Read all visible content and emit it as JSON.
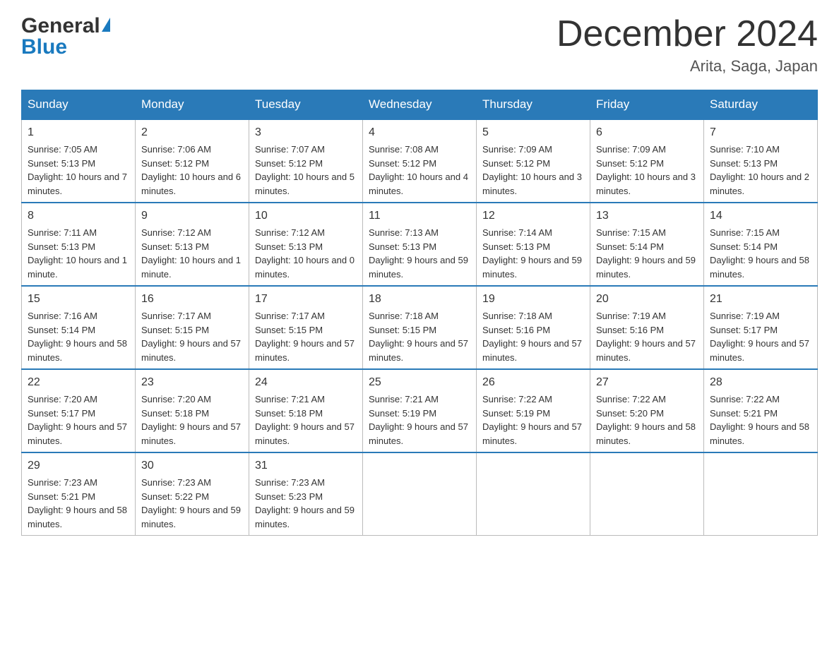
{
  "header": {
    "logo_general": "General",
    "logo_blue": "Blue",
    "month_title": "December 2024",
    "location": "Arita, Saga, Japan"
  },
  "calendar": {
    "days_of_week": [
      "Sunday",
      "Monday",
      "Tuesday",
      "Wednesday",
      "Thursday",
      "Friday",
      "Saturday"
    ],
    "weeks": [
      [
        {
          "day": "1",
          "sunrise": "7:05 AM",
          "sunset": "5:13 PM",
          "daylight": "10 hours and 7 minutes."
        },
        {
          "day": "2",
          "sunrise": "7:06 AM",
          "sunset": "5:12 PM",
          "daylight": "10 hours and 6 minutes."
        },
        {
          "day": "3",
          "sunrise": "7:07 AM",
          "sunset": "5:12 PM",
          "daylight": "10 hours and 5 minutes."
        },
        {
          "day": "4",
          "sunrise": "7:08 AM",
          "sunset": "5:12 PM",
          "daylight": "10 hours and 4 minutes."
        },
        {
          "day": "5",
          "sunrise": "7:09 AM",
          "sunset": "5:12 PM",
          "daylight": "10 hours and 3 minutes."
        },
        {
          "day": "6",
          "sunrise": "7:09 AM",
          "sunset": "5:12 PM",
          "daylight": "10 hours and 3 minutes."
        },
        {
          "day": "7",
          "sunrise": "7:10 AM",
          "sunset": "5:13 PM",
          "daylight": "10 hours and 2 minutes."
        }
      ],
      [
        {
          "day": "8",
          "sunrise": "7:11 AM",
          "sunset": "5:13 PM",
          "daylight": "10 hours and 1 minute."
        },
        {
          "day": "9",
          "sunrise": "7:12 AM",
          "sunset": "5:13 PM",
          "daylight": "10 hours and 1 minute."
        },
        {
          "day": "10",
          "sunrise": "7:12 AM",
          "sunset": "5:13 PM",
          "daylight": "10 hours and 0 minutes."
        },
        {
          "day": "11",
          "sunrise": "7:13 AM",
          "sunset": "5:13 PM",
          "daylight": "9 hours and 59 minutes."
        },
        {
          "day": "12",
          "sunrise": "7:14 AM",
          "sunset": "5:13 PM",
          "daylight": "9 hours and 59 minutes."
        },
        {
          "day": "13",
          "sunrise": "7:15 AM",
          "sunset": "5:14 PM",
          "daylight": "9 hours and 59 minutes."
        },
        {
          "day": "14",
          "sunrise": "7:15 AM",
          "sunset": "5:14 PM",
          "daylight": "9 hours and 58 minutes."
        }
      ],
      [
        {
          "day": "15",
          "sunrise": "7:16 AM",
          "sunset": "5:14 PM",
          "daylight": "9 hours and 58 minutes."
        },
        {
          "day": "16",
          "sunrise": "7:17 AM",
          "sunset": "5:15 PM",
          "daylight": "9 hours and 57 minutes."
        },
        {
          "day": "17",
          "sunrise": "7:17 AM",
          "sunset": "5:15 PM",
          "daylight": "9 hours and 57 minutes."
        },
        {
          "day": "18",
          "sunrise": "7:18 AM",
          "sunset": "5:15 PM",
          "daylight": "9 hours and 57 minutes."
        },
        {
          "day": "19",
          "sunrise": "7:18 AM",
          "sunset": "5:16 PM",
          "daylight": "9 hours and 57 minutes."
        },
        {
          "day": "20",
          "sunrise": "7:19 AM",
          "sunset": "5:16 PM",
          "daylight": "9 hours and 57 minutes."
        },
        {
          "day": "21",
          "sunrise": "7:19 AM",
          "sunset": "5:17 PM",
          "daylight": "9 hours and 57 minutes."
        }
      ],
      [
        {
          "day": "22",
          "sunrise": "7:20 AM",
          "sunset": "5:17 PM",
          "daylight": "9 hours and 57 minutes."
        },
        {
          "day": "23",
          "sunrise": "7:20 AM",
          "sunset": "5:18 PM",
          "daylight": "9 hours and 57 minutes."
        },
        {
          "day": "24",
          "sunrise": "7:21 AM",
          "sunset": "5:18 PM",
          "daylight": "9 hours and 57 minutes."
        },
        {
          "day": "25",
          "sunrise": "7:21 AM",
          "sunset": "5:19 PM",
          "daylight": "9 hours and 57 minutes."
        },
        {
          "day": "26",
          "sunrise": "7:22 AM",
          "sunset": "5:19 PM",
          "daylight": "9 hours and 57 minutes."
        },
        {
          "day": "27",
          "sunrise": "7:22 AM",
          "sunset": "5:20 PM",
          "daylight": "9 hours and 58 minutes."
        },
        {
          "day": "28",
          "sunrise": "7:22 AM",
          "sunset": "5:21 PM",
          "daylight": "9 hours and 58 minutes."
        }
      ],
      [
        {
          "day": "29",
          "sunrise": "7:23 AM",
          "sunset": "5:21 PM",
          "daylight": "9 hours and 58 minutes."
        },
        {
          "day": "30",
          "sunrise": "7:23 AM",
          "sunset": "5:22 PM",
          "daylight": "9 hours and 59 minutes."
        },
        {
          "day": "31",
          "sunrise": "7:23 AM",
          "sunset": "5:23 PM",
          "daylight": "9 hours and 59 minutes."
        },
        null,
        null,
        null,
        null
      ]
    ],
    "labels": {
      "sunrise": "Sunrise:",
      "sunset": "Sunset:",
      "daylight": "Daylight:"
    }
  }
}
